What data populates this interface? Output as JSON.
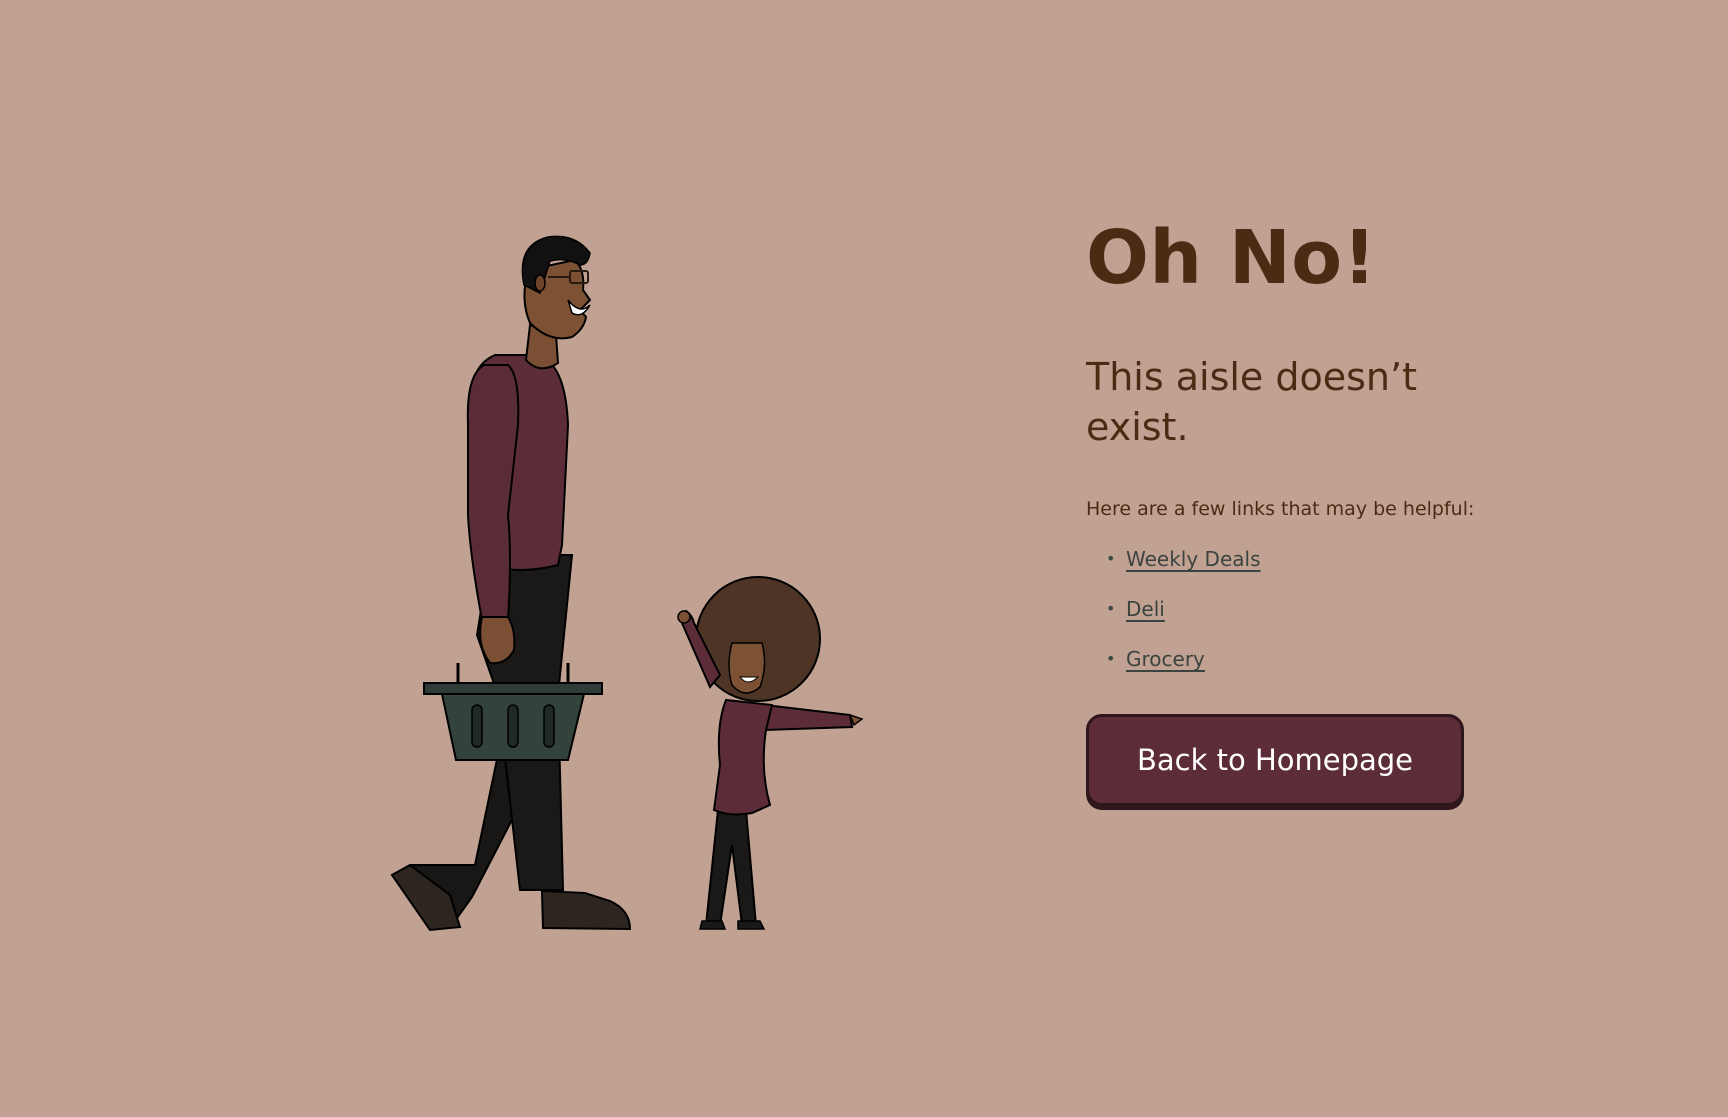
{
  "heading": {
    "title": "Oh No!",
    "subtitle": "This aisle doesn’t exist."
  },
  "helper_text": "Here are a few links that may be helpful:",
  "links": [
    {
      "label": "Weekly Deals"
    },
    {
      "label": "Deli"
    },
    {
      "label": "Grocery"
    }
  ],
  "cta": {
    "label": "Back to Homepage"
  },
  "colors": {
    "background": "#c1a191",
    "heading": "#4a2c15",
    "link": "#3b4440",
    "button": "#5c2d38",
    "button_text": "#ffffff"
  }
}
